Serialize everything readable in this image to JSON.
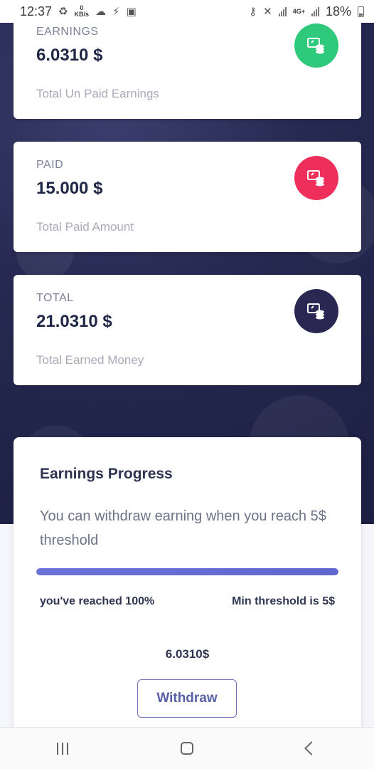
{
  "status_bar": {
    "time": "12:37",
    "net_speed_value": "0",
    "net_speed_unit": "KB/s",
    "network_type": "4G+",
    "battery": "18%"
  },
  "cards": {
    "earnings": {
      "label": "EARNINGS",
      "value": "6.0310 $",
      "subtitle": "Total Un Paid Earnings",
      "color": "#2ec97a"
    },
    "paid": {
      "label": "PAID",
      "value": "15.000 $",
      "subtitle": "Total Paid Amount",
      "color": "#ee2f5b"
    },
    "total": {
      "label": "TOTAL",
      "value": "21.0310 $",
      "subtitle": "Total Earned Money",
      "color": "#2a2752"
    }
  },
  "progress": {
    "title": "Earnings Progress",
    "description": "You can withdraw earning when you reach 5$ threshold",
    "percent": 100,
    "reached_text": "you've reached 100%",
    "min_threshold_text": "Min threshold is 5$",
    "amount": "6.0310$",
    "withdraw_label": "Withdraw"
  },
  "icons": {
    "card_icon": "coins-screen-icon",
    "nav_recents": "recents-icon",
    "nav_home": "home-icon",
    "nav_back": "back-icon"
  }
}
